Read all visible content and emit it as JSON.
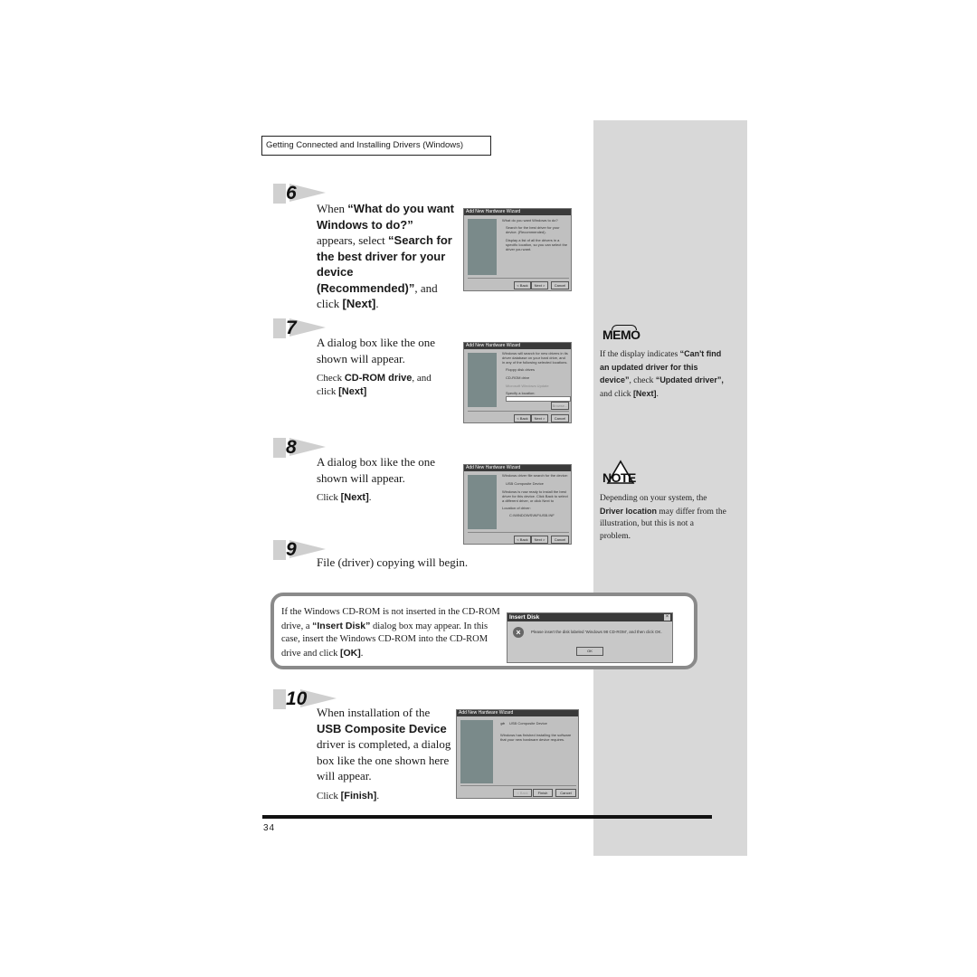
{
  "header": {
    "section_title": "Getting Connected and Installing Drivers (Windows)"
  },
  "steps": [
    {
      "number": "6",
      "text": [
        {
          "t": "When ",
          "bold": false
        },
        {
          "t": "“What do you want Windows to do?”",
          "bold": true
        },
        {
          "t": " appears, select ",
          "bold": false
        },
        {
          "t": "“Search for the best driver for your device (Recommended)”",
          "bold": true
        },
        {
          "t": ", and click ",
          "bold": false
        },
        {
          "t": "[Next]",
          "bold": true
        },
        {
          "t": ".",
          "bold": false
        }
      ],
      "dialog": {
        "title": "Add New Hardware Wizard",
        "lines": [
          "What do you want Windows to do?",
          "Search for the best driver for your device. (Recommended).",
          "Display a list of all the drivers in a specific location, so you can select the driver you want."
        ],
        "buttons": [
          "< Back",
          "Next >",
          "Cancel"
        ]
      }
    },
    {
      "number": "7",
      "text_main": "A dialog box like the one shown will appear.",
      "text_sub": [
        {
          "t": "Check ",
          "bold": false
        },
        {
          "t": "CD-ROM drive",
          "bold": true
        },
        {
          "t": ", and click ",
          "bold": false
        },
        {
          "t": "[Next]",
          "bold": true
        }
      ],
      "dialog": {
        "title": "Add New Hardware Wizard",
        "lines": [
          "Windows will search for new drivers in its driver database on your hard drive, and in any of the following selected locations. Click Next to start the search.",
          "Floppy disk drives",
          "CD-ROM drive",
          "Microsoft Windows Update",
          "Specify a location:"
        ],
        "buttons": [
          "< Back",
          "Next >",
          "Cancel"
        ],
        "browse": "Browse..."
      }
    },
    {
      "number": "8",
      "text_main": "A dialog box like the one shown will appear.",
      "text_sub": [
        {
          "t": "Click ",
          "bold": false
        },
        {
          "t": "[Next]",
          "bold": true
        },
        {
          "t": ".",
          "bold": false
        }
      ],
      "dialog": {
        "title": "Add New Hardware Wizard",
        "lines": [
          "Windows driver file search for the device:",
          "USB Composite Device",
          "Windows is now ready to install the best driver for this device. Click Back to select a different driver, or click Next to continue.",
          "Location of driver:",
          "C:\\WINDOWS\\INF\\USB.INF"
        ],
        "buttons": [
          "< Back",
          "Next >",
          "Cancel"
        ]
      }
    },
    {
      "number": "9",
      "text_main": "File (driver) copying will begin."
    },
    {
      "number": "10",
      "text_main": [
        {
          "t": "When installation of the ",
          "bold": false
        },
        {
          "t": "USB Composite Device",
          "bold": true
        },
        {
          "t": " driver is completed, a dialog box like the one shown here will appear.",
          "bold": false
        }
      ],
      "text_sub": [
        {
          "t": "Click ",
          "bold": false
        },
        {
          "t": "[Finish]",
          "bold": true
        },
        {
          "t": ".",
          "bold": false
        }
      ],
      "dialog": {
        "title": "Add New Hardware Wizard",
        "lines": [
          "USB Composite Device",
          "Windows has finished installing the software that your new hardware device requires."
        ],
        "buttons": [
          "< Back",
          "Finish",
          "Cancel"
        ]
      }
    }
  ],
  "callout": {
    "text": [
      {
        "t": "If the Windows CD-ROM is not inserted in the CD-ROM drive, a ",
        "bold": false
      },
      {
        "t": "“Insert Disk”",
        "bold": true
      },
      {
        "t": " dialog box may appear. In this case, insert the Windows CD-ROM into the CD-ROM drive and click ",
        "bold": false
      },
      {
        "t": "[OK]",
        "bold": true
      },
      {
        "t": ".",
        "bold": false
      }
    ],
    "dialog": {
      "title": "Insert Disk",
      "message": "Please insert the disk labeled 'Windows 98 CD-ROM', and then click OK.",
      "ok_label": "OK",
      "close_glyph": "×"
    }
  },
  "sidebar": {
    "memo": {
      "icon_label": "MEMO",
      "text": [
        {
          "t": "If the display indicates ",
          "bold": false
        },
        {
          "t": "“Can't find an updated driver for this device”",
          "bold": true
        },
        {
          "t": ", check ",
          "bold": false
        },
        {
          "t": "“Updated driver”,",
          "bold": true
        },
        {
          "t": " and click ",
          "bold": false
        },
        {
          "t": "[Next]",
          "bold": true
        },
        {
          "t": ".",
          "bold": false
        }
      ]
    },
    "note": {
      "icon_label": "NOTE",
      "text": [
        {
          "t": "Depending on your system, the ",
          "bold": false
        },
        {
          "t": "Driver location",
          "bold": true
        },
        {
          "t": " may differ from the illustration, but this is not a problem.",
          "bold": false
        }
      ]
    }
  },
  "footer": {
    "page_number": "34"
  },
  "colors": {
    "sidebar": "#d8d8d8",
    "callout_border": "#8a8a8a",
    "dialog_face": "#c0c0c0",
    "dialog_title": "#3a3a3a"
  }
}
